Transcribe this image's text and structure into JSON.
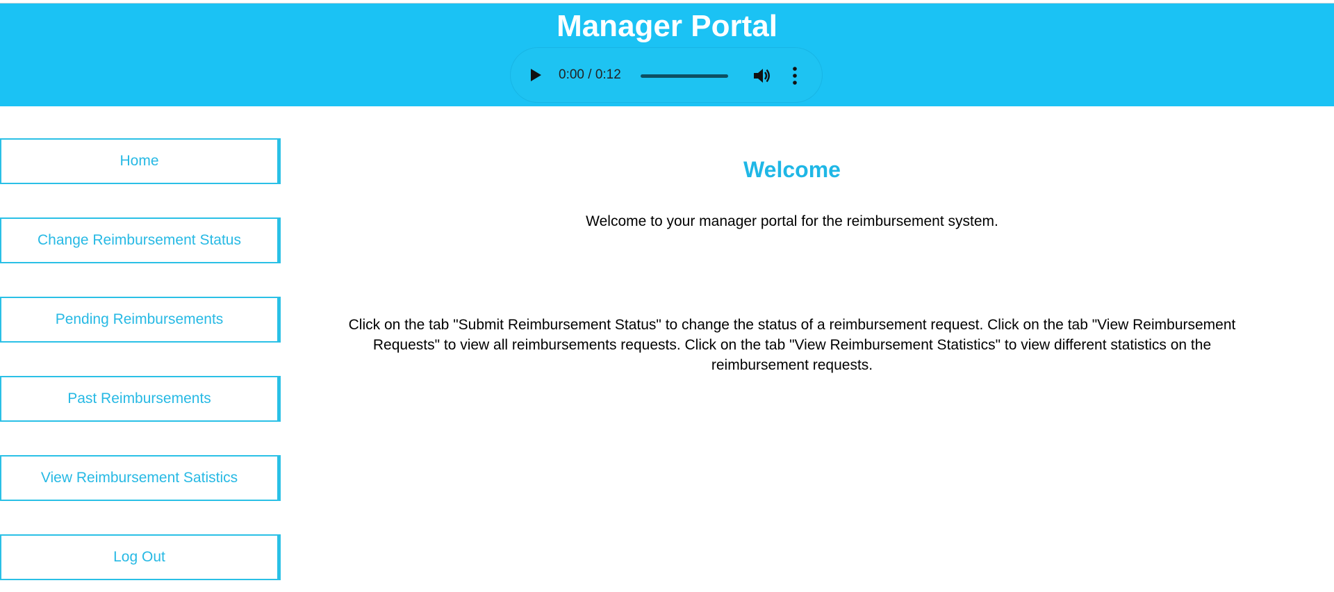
{
  "header": {
    "title": "Manager Portal",
    "background_color": "#1bc2f4"
  },
  "audio_player": {
    "current_time": "0:00",
    "duration": "0:12",
    "time_display": "0:00 / 0:12",
    "progress": 0,
    "play_icon": "play-icon",
    "volume_icon": "volume-icon",
    "menu_icon": "more-vertical-icon"
  },
  "sidebar": {
    "accent_color": "#2ac0e6",
    "items": [
      {
        "label": "Home"
      },
      {
        "label": "Change Reimbursement Status"
      },
      {
        "label": "Pending Reimbursements"
      },
      {
        "label": "Past Reimbursements"
      },
      {
        "label": "View Reimbursement Satistics"
      },
      {
        "label": "Log Out"
      }
    ]
  },
  "main": {
    "heading": "Welcome",
    "heading_color": "#1fb7e6",
    "intro": "Welcome to your manager portal for the reimbursement system.",
    "instructions": "Click on the tab \"Submit Reimbursement Status\" to change the status of a reimbursement request. Click on the tab \"View Reimbursement Requests\" to view all reimbursements requests. Click on the tab \"View Reimbursement Statistics\" to view different statistics on the reimbursement requests."
  }
}
